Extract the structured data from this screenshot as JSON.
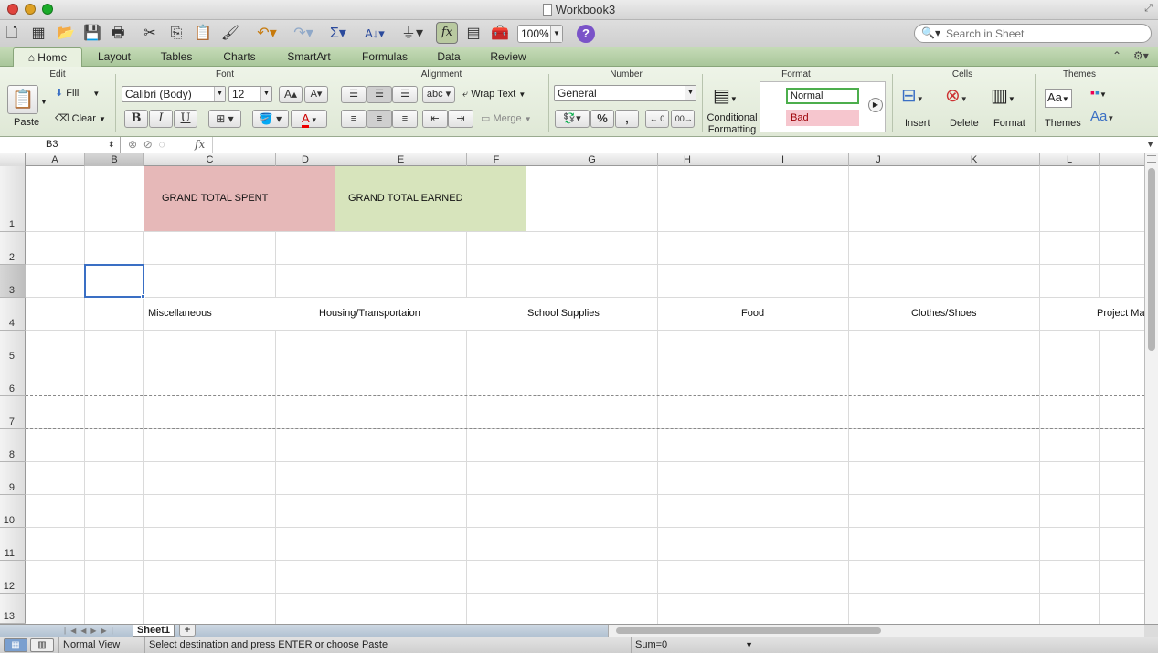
{
  "window": {
    "title": "Workbook3"
  },
  "toolbar": {
    "zoom": "100%",
    "search_placeholder": "Search in Sheet",
    "help_label": "?",
    "fx_label": "fx"
  },
  "ribbon_tabs": [
    "Home",
    "Layout",
    "Tables",
    "Charts",
    "SmartArt",
    "Formulas",
    "Data",
    "Review"
  ],
  "ribbon": {
    "groups": {
      "edit": "Edit",
      "font": "Font",
      "alignment": "Alignment",
      "number": "Number",
      "format": "Format",
      "cells": "Cells",
      "themes": "Themes"
    },
    "paste": "Paste",
    "fill": "Fill",
    "clear": "Clear",
    "font_name": "Calibri (Body)",
    "font_size": "12",
    "bold": "B",
    "italic": "I",
    "underline": "U",
    "wrap_text": "Wrap Text",
    "merge": "Merge",
    "number_format": "General",
    "percent": "%",
    "comma": ",",
    "conditional_formatting_1": "Conditional",
    "conditional_formatting_2": "Formatting",
    "style_normal": "Normal",
    "style_bad": "Bad",
    "insert": "Insert",
    "delete": "Delete",
    "format": "Format",
    "themes": "Themes",
    "abc": "abc",
    "aa_large": "Aa",
    "grow_font": "A",
    "shrink_font": "A"
  },
  "formula_bar": {
    "cell_ref": "B3",
    "fx": "fx",
    "value": ""
  },
  "columns": [
    "A",
    "B",
    "C",
    "D",
    "E",
    "F",
    "G",
    "H",
    "I",
    "J",
    "K",
    "L"
  ],
  "rows": [
    "1",
    "2",
    "3",
    "4",
    "5",
    "6",
    "7",
    "8",
    "9",
    "10",
    "11",
    "12",
    "13"
  ],
  "selected": {
    "column": "B",
    "row": "3"
  },
  "cells": {
    "c1": "GRAND TOTAL SPENT",
    "e1": "GRAND TOTAL EARNED",
    "b4": "Miscellaneous",
    "d4": "Housing/Transportaion",
    "f4": "School Supplies",
    "h4": "Food",
    "j4": "Clothes/Shoes",
    "l4": "Project Ma"
  },
  "colors": {
    "spent_fill": "#e6b8b8",
    "earned_fill": "#d7e4bc",
    "selection": "#3a6fc4"
  },
  "sheets": [
    "Sheet1"
  ],
  "add_sheet": "+",
  "status": {
    "view": "Normal View",
    "message": "Select destination and press ENTER or choose Paste",
    "sum": "Sum=0"
  }
}
